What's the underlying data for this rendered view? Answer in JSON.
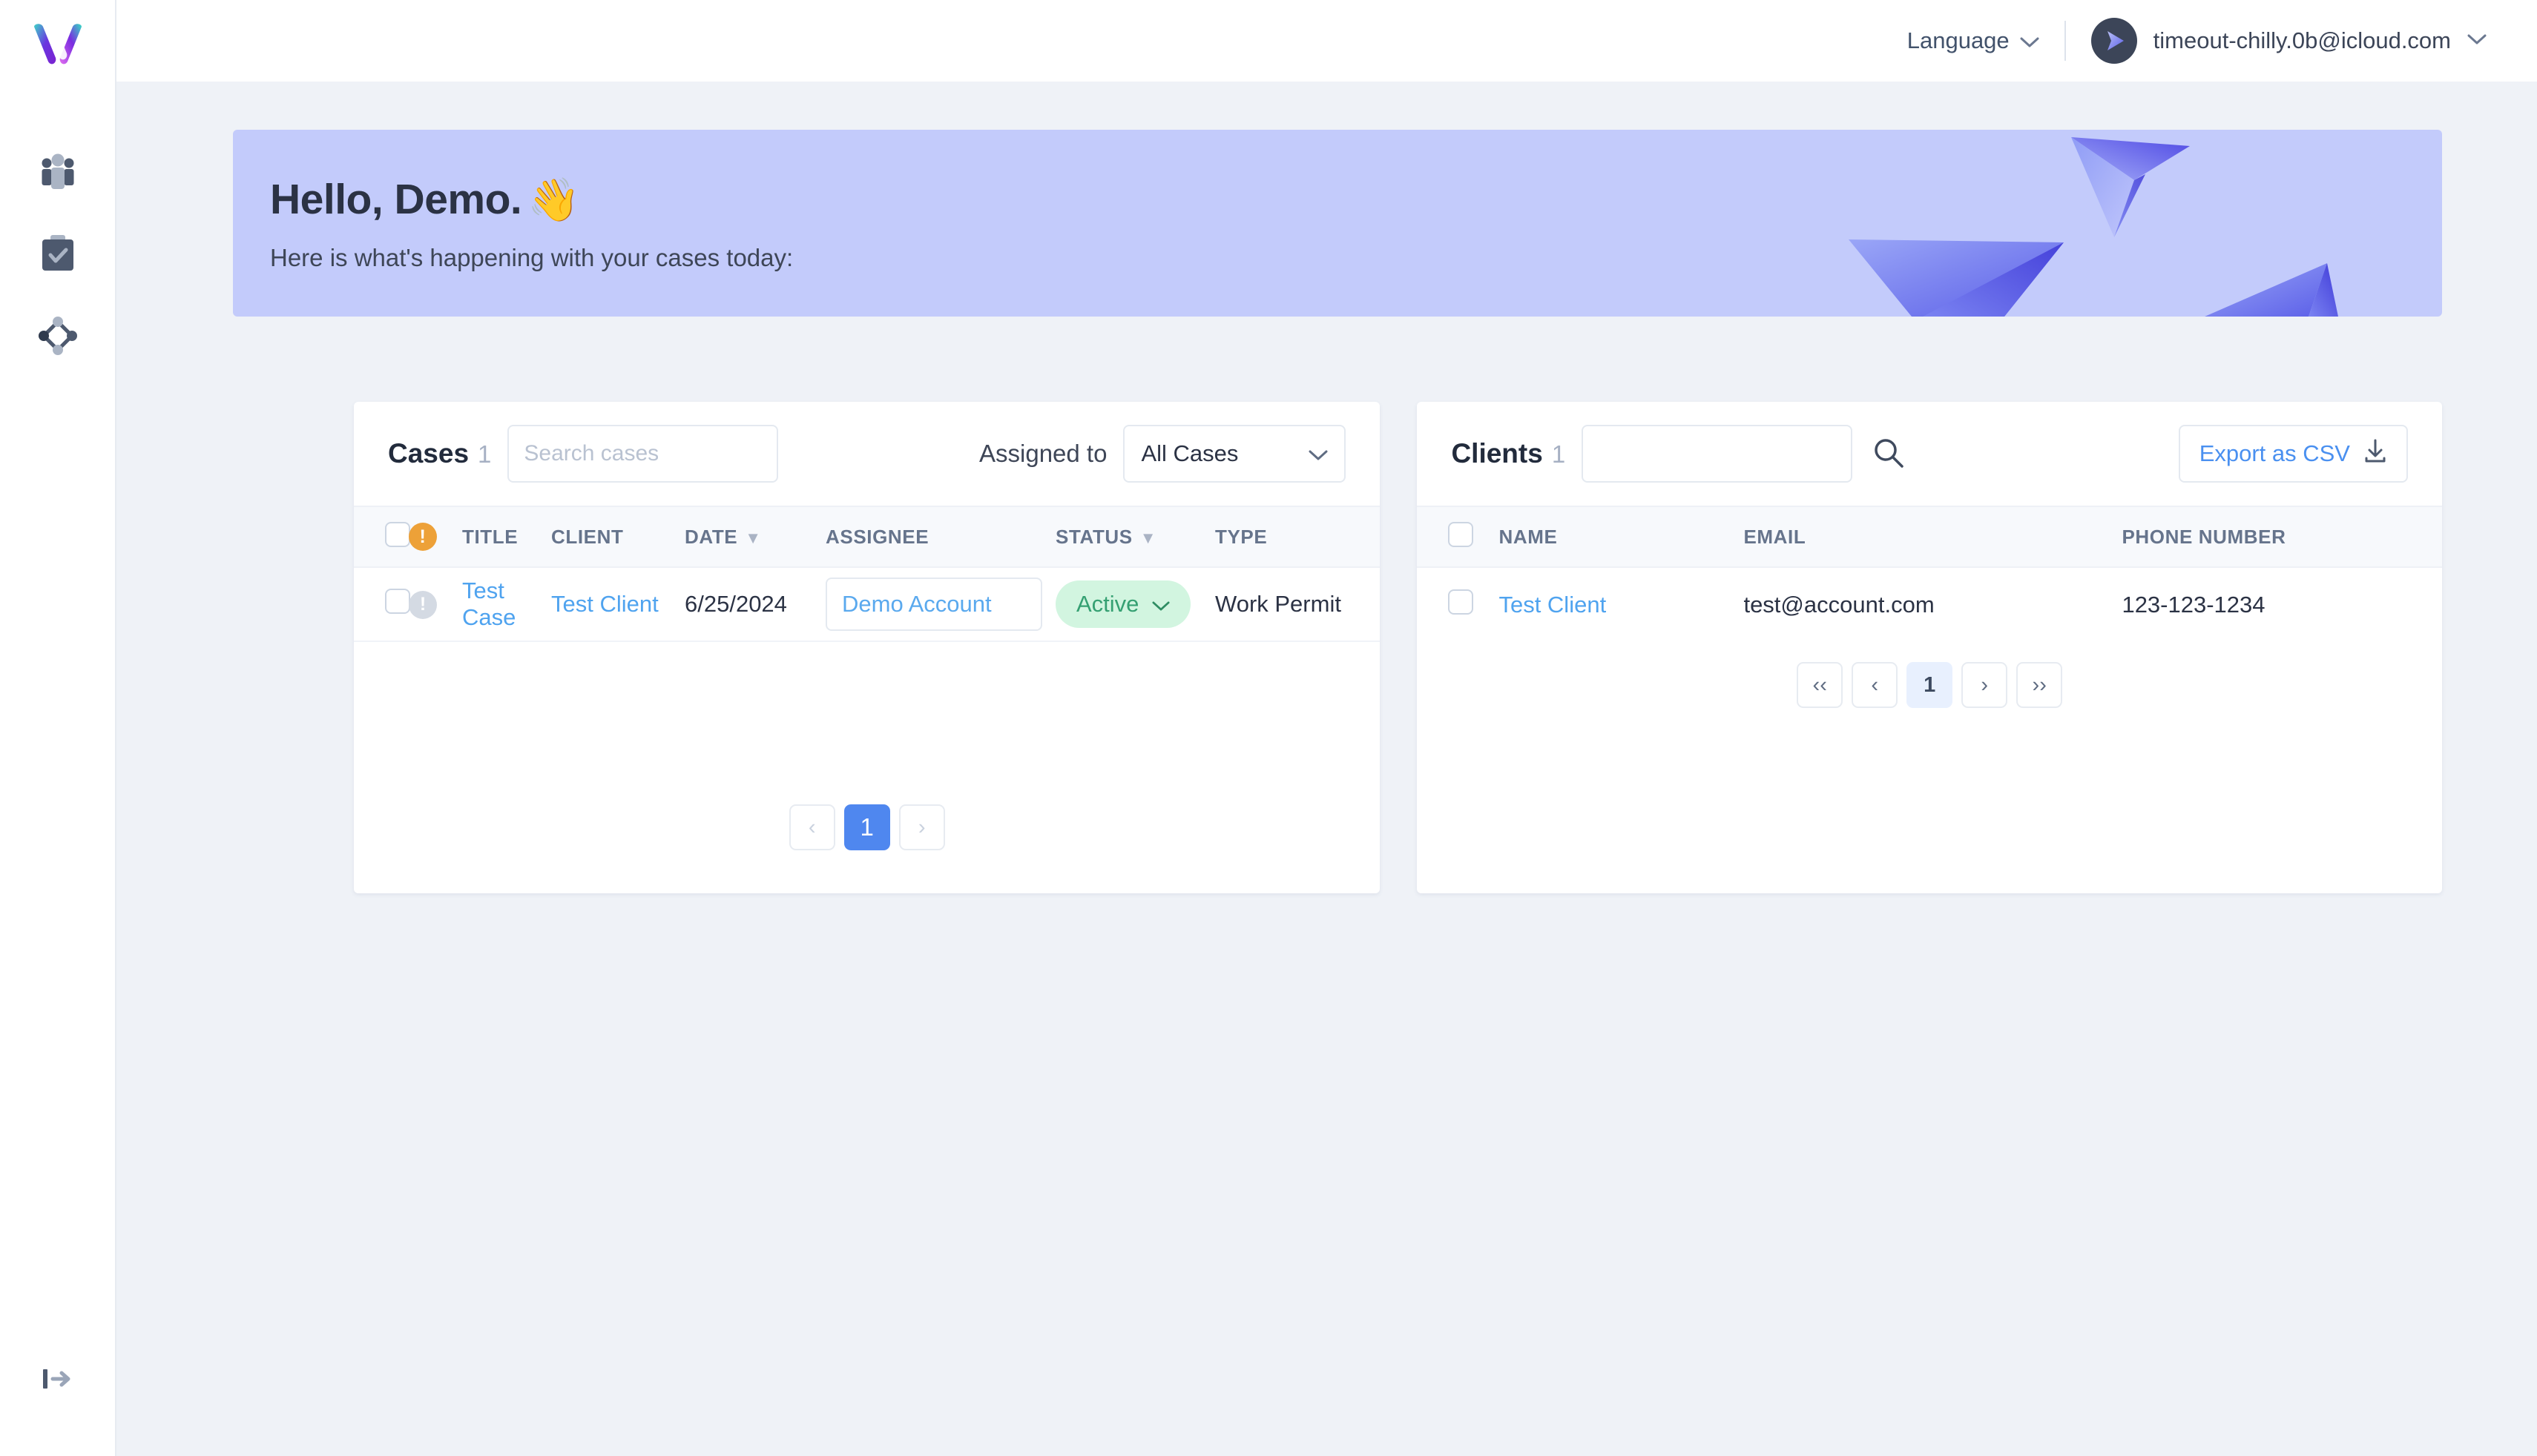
{
  "app": {
    "logo_name": "vesta-logo"
  },
  "sidebar": {
    "items": [
      {
        "name": "clients",
        "icon": "people-icon"
      },
      {
        "name": "cases",
        "icon": "clipboard-check-icon"
      },
      {
        "name": "workflows",
        "icon": "network-diamond-icon"
      }
    ],
    "collapse_icon": "expand-sidebar-icon"
  },
  "topbar": {
    "language_label": "Language",
    "language_caret": "⌄",
    "user_email": "timeout-chilly.0b@icloud.com",
    "user_caret": "⌄",
    "avatar_icon": "arrow-cursor-avatar"
  },
  "hero": {
    "greeting": "Hello, Demo.",
    "wave_emoji": "👋",
    "subtitle": "Here is what's happening with your cases today:",
    "background_color": "#c3cbfb"
  },
  "cases_panel": {
    "title": "Cases",
    "count": "1",
    "search_placeholder": "Search cases",
    "search_value": "",
    "assigned_to_label": "Assigned to",
    "assigned_to_value": "All Cases",
    "columns": [
      "TITLE",
      "CLIENT",
      "DATE",
      "ASSIGNEE",
      "STATUS",
      "TYPE"
    ],
    "sortable": {
      "date": "▼",
      "status": "▼"
    },
    "rows": [
      {
        "alert": "info-icon",
        "title": "Test Case",
        "client": "Test Client",
        "date": "6/25/2024",
        "assignee": "Demo Account",
        "status": "Active",
        "type": "Work Permit"
      }
    ],
    "pagination": {
      "prev": "‹",
      "next": "›",
      "pages": [
        "1"
      ],
      "current": "1"
    }
  },
  "clients_panel": {
    "title": "Clients",
    "count": "1",
    "search_placeholder": "",
    "search_value": "",
    "search_icon": "search-icon",
    "export_label": "Export as CSV",
    "export_icon": "download-icon",
    "columns": [
      "NAME",
      "EMAIL",
      "PHONE NUMBER"
    ],
    "rows": [
      {
        "name": "Test Client",
        "email": "test@account.com",
        "phone": "123-123-1234"
      }
    ],
    "pagination": {
      "first": "‹‹",
      "prev": "‹",
      "pages": [
        "1"
      ],
      "current": "1",
      "next": "›",
      "last": "››"
    }
  },
  "colors": {
    "accent_blue": "#4f87ef",
    "link_blue": "#4fa3ef",
    "status_green_bg": "#d2f5e0",
    "status_green_text": "#35a072",
    "alert_orange": "#eda138",
    "page_bg": "#eff2f7"
  }
}
